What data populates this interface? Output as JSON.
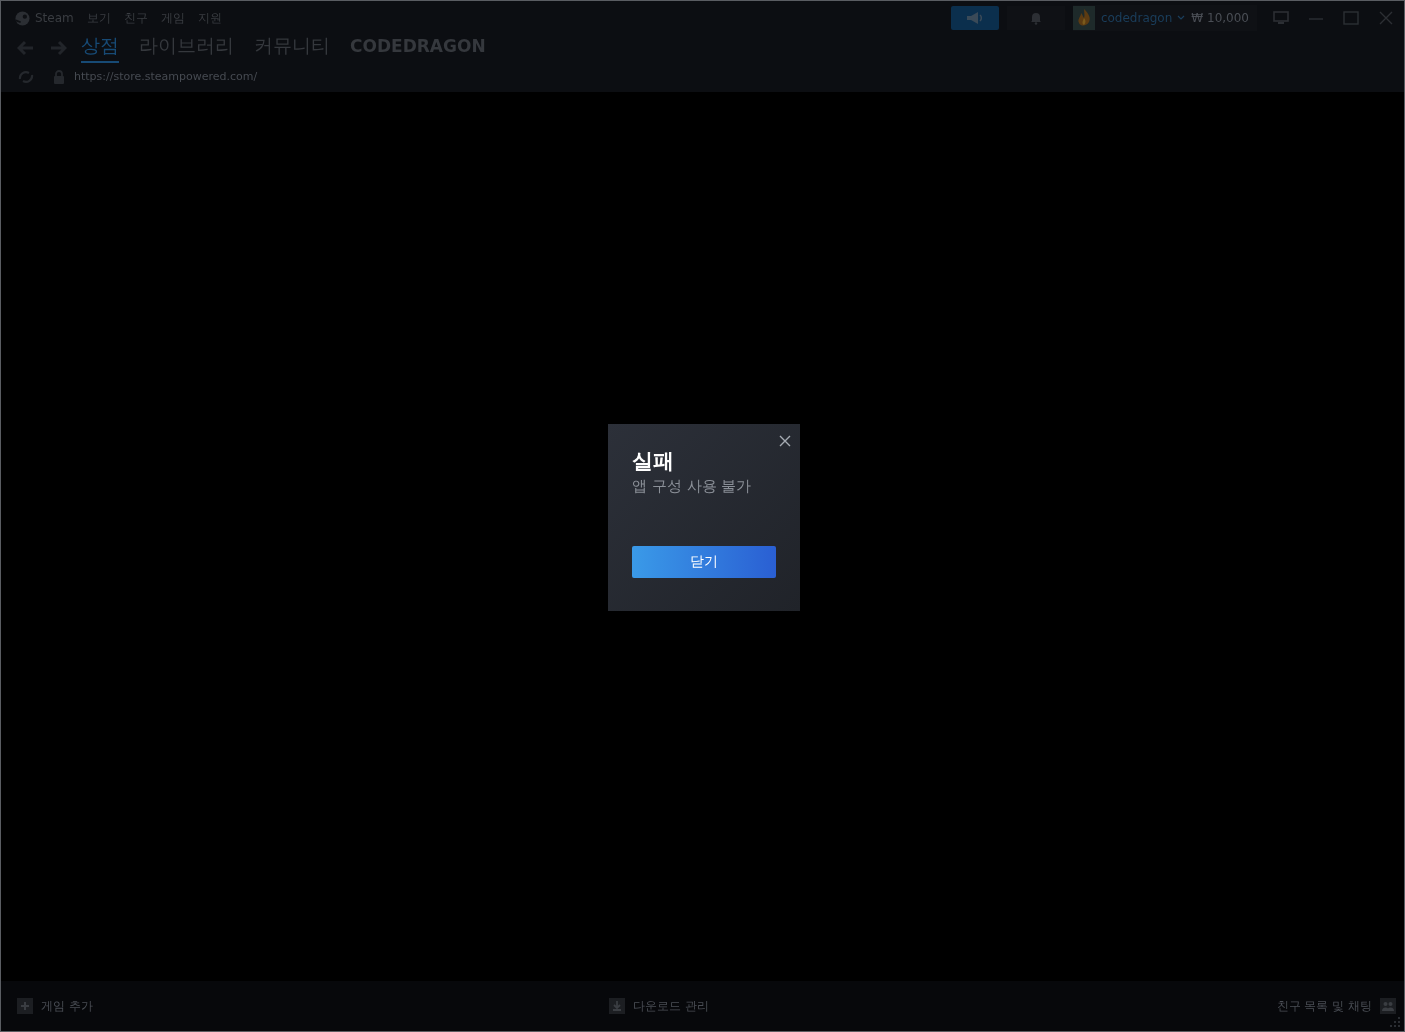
{
  "menu": [
    "Steam",
    "보기",
    "친구",
    "게임",
    "지원"
  ],
  "nav_tabs": [
    {
      "label": "상점",
      "selected": true
    },
    {
      "label": "라이브러리",
      "selected": false
    },
    {
      "label": "커뮤니티",
      "selected": false
    },
    {
      "label": "CODEDRAGON",
      "selected": false
    }
  ],
  "url": "https://store.steampowered.com/",
  "account": {
    "username": "codedragon",
    "balance": "₩ 10,000"
  },
  "dialog": {
    "title": "실패",
    "message": "앱 구성 사용 불가",
    "button": "닫기"
  },
  "footer": {
    "add_game": "게임 추가",
    "downloads": "다운로드 관리",
    "friends": "친구 목록 및 채팅"
  }
}
